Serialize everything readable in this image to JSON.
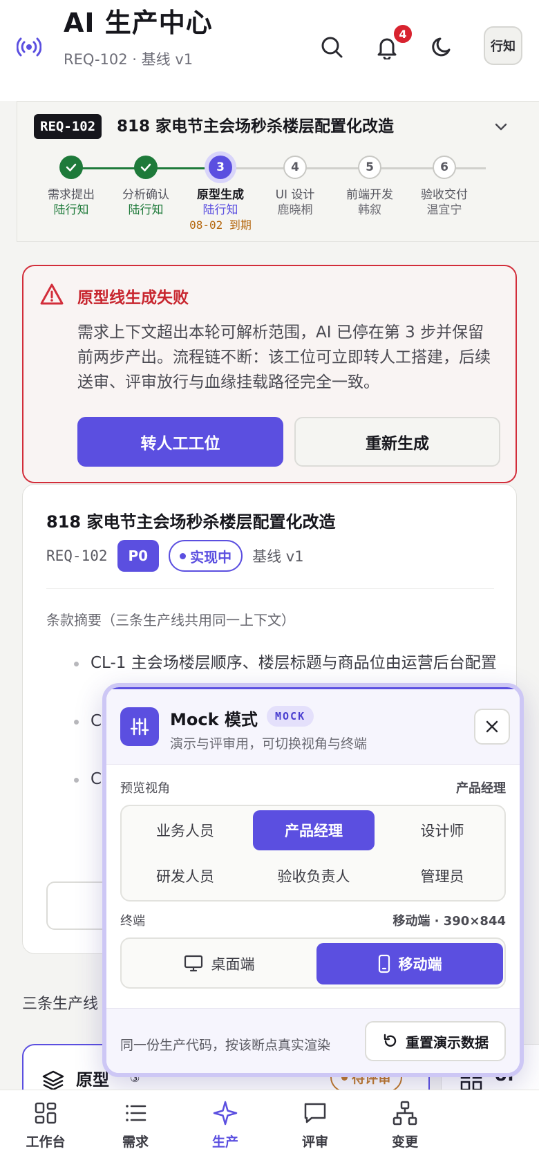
{
  "header": {
    "title": "AI 生产中心",
    "subtitle": "REQ-102 · 基线 v1",
    "notification_count": "4",
    "avatar_label": "行知"
  },
  "requirement": {
    "code": "REQ-102",
    "title": "818 家电节主会场秒杀楼层配置化改造",
    "steps": [
      {
        "name": "需求提出",
        "owner": "陆行知",
        "state": "done"
      },
      {
        "name": "分析确认",
        "owner": "陆行知",
        "state": "done"
      },
      {
        "name": "原型生成",
        "owner": "陆行知",
        "state": "current",
        "number": "3",
        "due": "08-02 到期"
      },
      {
        "name": "UI 设计",
        "owner": "鹿晓桐",
        "state": "todo",
        "number": "4"
      },
      {
        "name": "前端开发",
        "owner": "韩叙",
        "state": "todo",
        "number": "5"
      },
      {
        "name": "验收交付",
        "owner": "温宜宁",
        "state": "todo",
        "number": "6"
      }
    ]
  },
  "error": {
    "title": "原型线生成失败",
    "body": "需求上下文超出本轮可解析范围，AI 已停在第 3 步并保留前两步产出。流程链不断：该工位可立即转人工搭建，后续送审、评审放行与血缘挂载路径完全一致。",
    "primary_label": "转人工工位",
    "secondary_label": "重新生成"
  },
  "detail": {
    "title": "818 家电节主会场秒杀楼层配置化改造",
    "code": "REQ-102",
    "priority": "P0",
    "status": "实现中",
    "baseline": "基线 v1",
    "summary_label": "条款摘要（三条生产线共用同一上下文）",
    "clauses": [
      "CL-1 主会场楼层顺序、楼层标题与商品位由运营后台配置",
      "C",
      "C"
    ]
  },
  "lines": {
    "title": "三条生产线",
    "prototype_label": "原型",
    "prototype_num": "③",
    "prototype_status": "待评审",
    "ui_label": "UI"
  },
  "mock": {
    "title": "Mock 模式",
    "badge": "MOCK",
    "subtitle": "演示与评审用，可切换视角与终端",
    "view_label": "预览视角",
    "view_value": "产品经理",
    "roles": [
      "业务人员",
      "产品经理",
      "设计师",
      "研发人员",
      "验收负责人",
      "管理员"
    ],
    "selected_role": "产品经理",
    "terminal_label": "终端",
    "terminal_value": "移动端 · 390×844",
    "terminals": [
      "桌面端",
      "移动端"
    ],
    "footer_text": "同一份生产代码，按该断点真实渲染",
    "reset_label": "重置演示数据"
  },
  "nav": {
    "items": [
      {
        "label": "工作台",
        "icon": "dashboard-icon"
      },
      {
        "label": "需求",
        "icon": "list-icon"
      },
      {
        "label": "生产",
        "icon": "sparkle-icon"
      },
      {
        "label": "评审",
        "icon": "chat-icon"
      },
      {
        "label": "变更",
        "icon": "tree-icon"
      }
    ],
    "active": "生产"
  },
  "colors": {
    "accent": "#5b4fe0",
    "success": "#1e7a3a",
    "danger": "#d22d3a",
    "warning": "#c27a24"
  }
}
